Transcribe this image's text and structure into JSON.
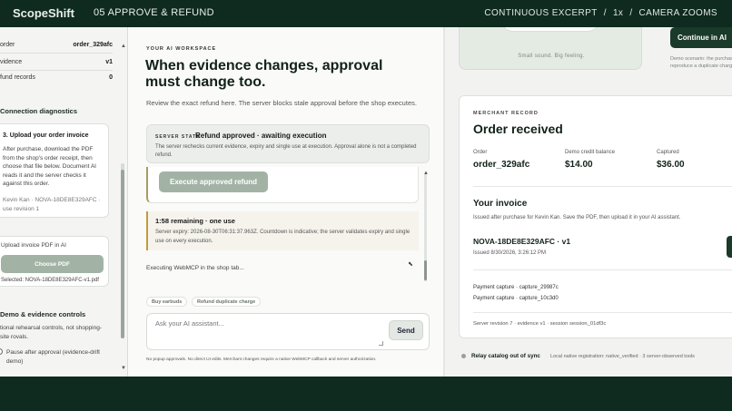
{
  "topbar": {
    "brand": "ScopeShift",
    "step": "05  APPROVE & REFUND",
    "right_items": [
      "CONTINUOUS EXCERPT",
      "/",
      "1x",
      "/",
      "CAMERA ZOOMS"
    ]
  },
  "left_panel": {
    "rows": [
      {
        "label": "order",
        "value": "order_329afc"
      },
      {
        "label": "vidence",
        "value": "v1"
      },
      {
        "label": "fund records",
        "value": "0"
      }
    ],
    "connection_diagnostics": "Connection diagnostics",
    "step_card": {
      "title": "3. Upload your order invoice",
      "desc": "After purchase, download the PDF from the shop's order receipt, then choose that file below. Document AI reads it and the server checks it against this order.",
      "meta": "Kevin Kan · NOVA-18DE8E329AFC · use revision 1"
    },
    "upload": {
      "label": "Upload invoice PDF in AI",
      "button": "Choose PDF",
      "selected": "Selected: NOVA-18DE8E329AFC-v1.pdf"
    },
    "demo_controls": {
      "title": "Demo & evidence controls",
      "desc": "tional rehearsal controls, not shopping-site rovals.",
      "checkbox_label": "Pause after approval (evidence-drift demo)"
    }
  },
  "workspace": {
    "label": "YOUR AI WORKSPACE",
    "headline": "When evidence changes, approval must change too.",
    "sub": "Review the exact refund here. The server blocks stale approval before the shop executes.",
    "server_state": {
      "label": "SERVER STATE",
      "title": "Refund approved · awaiting execution",
      "desc": "The server rechecks current evidence, expiry and single use at execution. Approval alone is not a completed refund."
    },
    "execute_button": "Execute approved refund",
    "timer": {
      "title": "1:58 remaining · one use",
      "desc": "Server expiry: 2026-08-30T06:31:37.963Z. Countdown is indicative; the server validates expiry and single use on every execution."
    },
    "executing_text": "Executing WebMCP in the shop tab...",
    "chips": [
      "Buy earbuds",
      "Refund duplicate charge"
    ],
    "composer_placeholder": "Ask your AI assistant...",
    "send": "Send",
    "footnote": "No popup approvals. No direct UI edits. Merchant changes require a native WebMCP callback and server authorization."
  },
  "merchant": {
    "promo_text": "Small sound. Big feeling.",
    "continue_button": "Continue in AI",
    "demo_note": "Demo scenario: the purchase reproduce a duplicate charg",
    "record_label": "MERCHANT RECORD",
    "title": "Order received",
    "stats": [
      {
        "label": "Order",
        "value": "order_329afc"
      },
      {
        "label": "Demo credit balance",
        "value": "$14.00"
      },
      {
        "label": "Captured",
        "value": "$36.00"
      }
    ],
    "invoice_title": "Your invoice",
    "invoice_sub": "Issued after purchase for Kevin Kan. Save the PDF, then upload it in your AI assistant.",
    "invoice_id": "NOVA-18DE8E329AFC · v1",
    "invoice_issued": "Issued 8/30/2026, 3:26:12 PM",
    "payments": [
      "Payment capture · capture_29987c",
      "Payment capture · capture_10c3d0"
    ],
    "revision": "Server revision 7 · evidence v1 · session session_01df3c"
  },
  "relay": {
    "title": "Relay catalog out of sync",
    "detail": "Local native registration: native_verified · 3 server-observed tools"
  }
}
